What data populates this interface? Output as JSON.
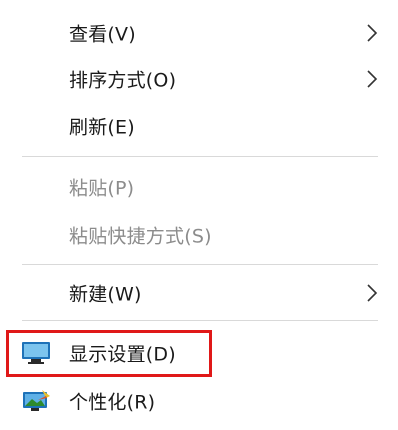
{
  "menu": {
    "items": [
      {
        "label": "查看(V)",
        "has_submenu": true,
        "enabled": true
      },
      {
        "label": "排序方式(O)",
        "has_submenu": true,
        "enabled": true
      },
      {
        "label": "刷新(E)",
        "has_submenu": false,
        "enabled": true
      },
      {
        "label": "粘贴(P)",
        "has_submenu": false,
        "enabled": false
      },
      {
        "label": "粘贴快捷方式(S)",
        "has_submenu": false,
        "enabled": false
      },
      {
        "label": "新建(W)",
        "has_submenu": true,
        "enabled": true
      },
      {
        "label": "显示设置(D)",
        "has_submenu": false,
        "enabled": true,
        "icon": "monitor-icon",
        "highlighted": true
      },
      {
        "label": "个性化(R)",
        "has_submenu": false,
        "enabled": true,
        "icon": "personalize-icon"
      }
    ]
  },
  "colors": {
    "highlight_border": "#e01818",
    "text": "#1a1a1a",
    "disabled_text": "#8c8c8c",
    "separator": "#d9d9d9"
  }
}
